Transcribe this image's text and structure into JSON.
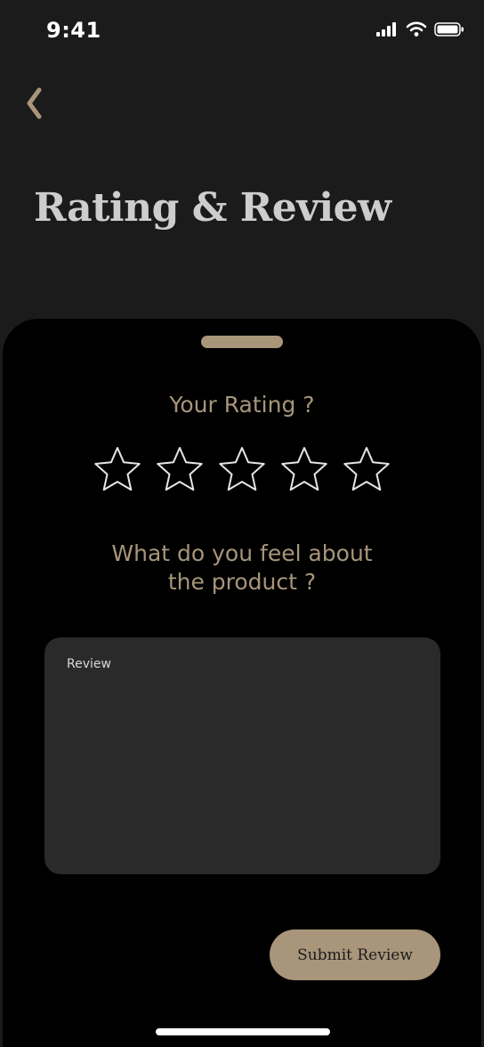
{
  "status_bar": {
    "time": "9:41",
    "icons": [
      "signal-icon",
      "wifi-icon",
      "battery-icon"
    ]
  },
  "header": {
    "back_icon": "chevron-left-icon",
    "title": "Rating & Review"
  },
  "rating": {
    "question": "Your Rating ?",
    "max_stars": 5,
    "value": 0
  },
  "feedback": {
    "question_line1": "What do you feel about",
    "question_line2": "the product ?",
    "placeholder": "Review"
  },
  "actions": {
    "submit_label": "Submit Review"
  },
  "colors": {
    "background": "#1b1b1b",
    "sheet": "#000000",
    "accent": "#a8957a",
    "input_bg": "#2a2a2a",
    "title": "#cdcdcd"
  }
}
